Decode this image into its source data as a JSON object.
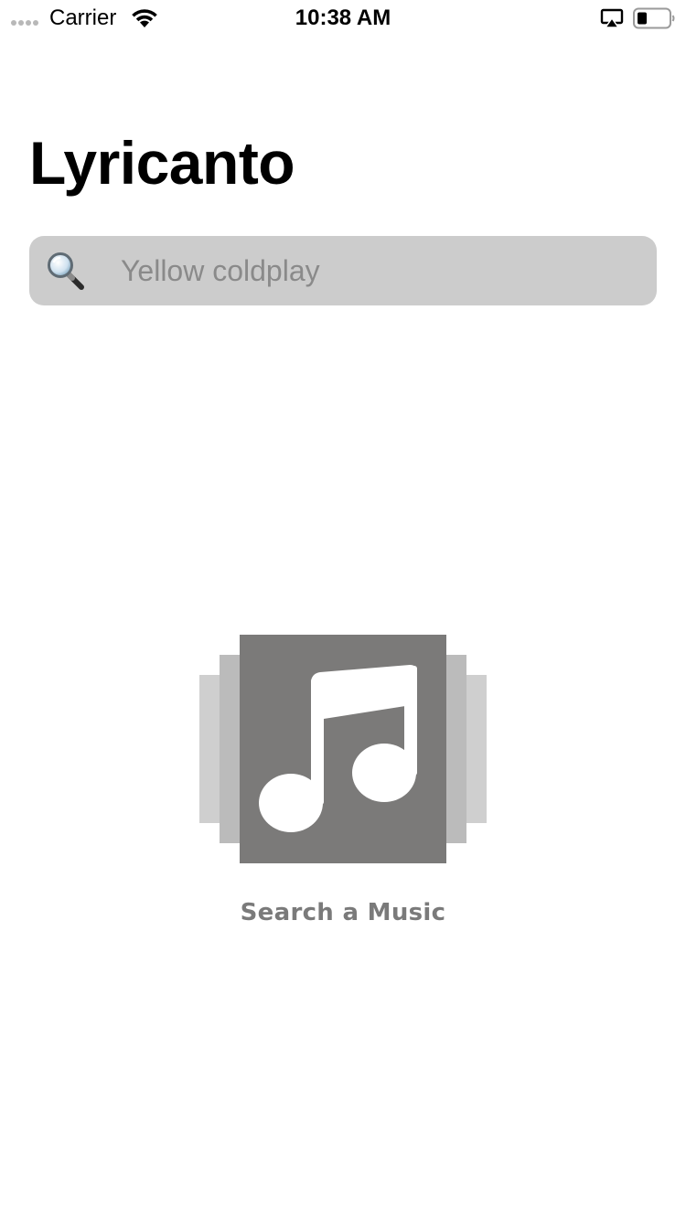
{
  "status_bar": {
    "carrier": "Carrier",
    "time": "10:38 AM"
  },
  "header": {
    "title": "Lyricanto"
  },
  "search": {
    "placeholder": "Yellow coldplay",
    "value": "",
    "icon": "magnifying-glass-icon"
  },
  "empty_state": {
    "icon": "music-note-album-icon",
    "label": "Search a Music"
  },
  "colors": {
    "search_bg": "#cccccc",
    "placeholder": "#8a8a8a",
    "empty_label": "#7a7a7a",
    "album_front": "#7b7a79",
    "album_mid": "#bbbbbb",
    "album_back": "#cfcfcf"
  }
}
